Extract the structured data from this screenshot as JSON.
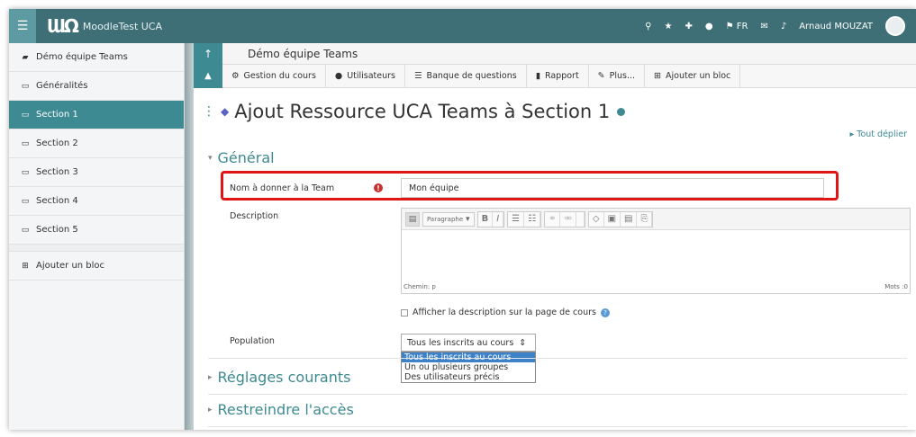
{
  "navbar": {
    "site_name": "MoodleTest UCA",
    "lang": "FR",
    "user_name": "Arnaud MOUZAT",
    "accent": "#3e6f76"
  },
  "drawer": {
    "items": [
      {
        "label": "Démo équipe Teams",
        "icon": "graduation-cap-icon",
        "active": false
      },
      {
        "label": "Généralités",
        "icon": "folder-icon",
        "active": false
      },
      {
        "label": "Section 1",
        "icon": "folder-icon",
        "active": true
      },
      {
        "label": "Section 2",
        "icon": "folder-icon",
        "active": false
      },
      {
        "label": "Section 3",
        "icon": "folder-icon",
        "active": false
      },
      {
        "label": "Section 4",
        "icon": "folder-icon",
        "active": false
      },
      {
        "label": "Section 5",
        "icon": "folder-icon",
        "active": false
      }
    ],
    "add_block": "Ajouter un bloc"
  },
  "course_bar": {
    "title": "Démo équipe Teams"
  },
  "toolbar": {
    "items": [
      "Gestion du cours",
      "Utilisateurs",
      "Banque de questions",
      "Rapport",
      "Plus...",
      "Ajouter un bloc"
    ]
  },
  "page": {
    "title": "Ajout Ressource UCA Teams à Section 1",
    "expand_all": "▸ Tout déplier"
  },
  "general": {
    "heading": "Général",
    "team_name_label": "Nom à donner à la Team",
    "team_name_value": "Mon équipe",
    "description_label": "Description",
    "editor_paragraph": "Paragraphe",
    "editor_path": "Chemin: p",
    "editor_words": "Mots :0",
    "show_description": "Afficher la description sur la page de cours",
    "population_label": "Population",
    "population_selected": "Tous les inscrits au cours",
    "population_options": [
      "Tous les inscrits au cours",
      "Un ou plusieurs groupes",
      "Des utilisateurs précis"
    ]
  },
  "sections": {
    "common": "Réglages courants",
    "restrict": "Restreindre l'accès"
  }
}
